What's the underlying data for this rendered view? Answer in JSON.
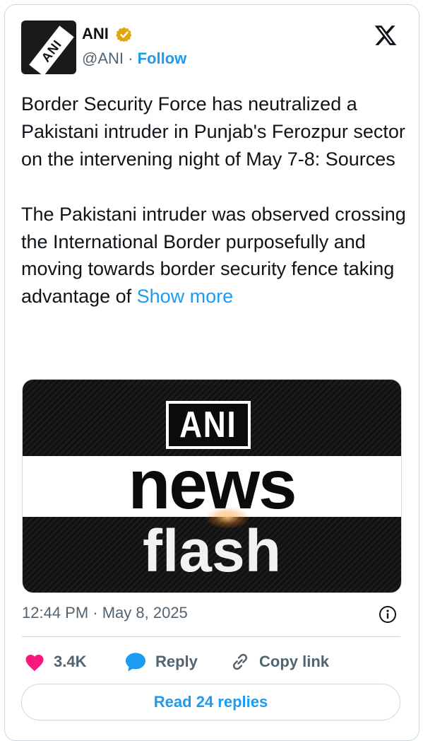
{
  "author": {
    "name": "ANI",
    "handle": "@ANI",
    "separator": " · ",
    "follow_label": "Follow",
    "avatar_text": "ANI",
    "verified_color": "#e2a60f"
  },
  "tweet": {
    "paragraph1": "Border Security Force has neutralized a Pakistani intruder in Punjab's Ferozpur sector on the intervening night of May 7-8: Sources",
    "paragraph2": "The Pakistani intruder was observed crossing the International Border purposefully and moving towards border security fence taking advantage of ",
    "show_more": "Show more"
  },
  "media": {
    "box_text": "ANI",
    "line1": "news",
    "line2": "flash"
  },
  "meta": {
    "timestamp": "12:44 PM · May 8, 2025"
  },
  "actions": {
    "like_count": "3.4K",
    "reply_label": "Reply",
    "copy_label": "Copy link"
  },
  "footer": {
    "read_replies": "Read 24 replies"
  },
  "colors": {
    "accent": "#1d9bf0",
    "like": "#f91880",
    "reply_icon": "#1d9bf0",
    "muted": "#536471"
  }
}
